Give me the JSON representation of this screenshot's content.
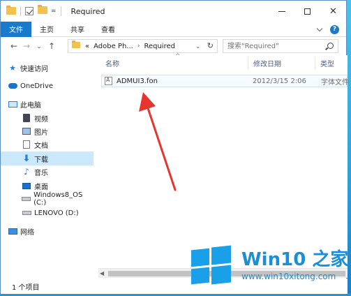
{
  "window": {
    "title": "Required",
    "qa_dropdown": "="
  },
  "ribbon": {
    "file_tab": "文件",
    "tabs": [
      "主页",
      "共享",
      "查看"
    ]
  },
  "address": {
    "prefix": "«",
    "crumbs": [
      "Adobe Ph...",
      "Required"
    ],
    "separator": "›"
  },
  "search": {
    "placeholder": "搜索\"Required\""
  },
  "nav_pane": {
    "items": [
      {
        "label": "快速访问",
        "icon": "star-icon"
      },
      {
        "label": "OneDrive",
        "icon": "onedrive-icon"
      },
      {
        "label": "此电脑",
        "icon": "this-pc-icon"
      },
      {
        "label": "视频",
        "icon": "video-icon"
      },
      {
        "label": "图片",
        "icon": "picture-icon"
      },
      {
        "label": "文档",
        "icon": "document-icon"
      },
      {
        "label": "下载",
        "icon": "download-icon",
        "selected": true
      },
      {
        "label": "音乐",
        "icon": "music-icon"
      },
      {
        "label": "桌面",
        "icon": "desktop-icon"
      },
      {
        "label": "Windows8_OS (C:)",
        "icon": "drive-icon"
      },
      {
        "label": "LENOVO (D:)",
        "icon": "drive-icon"
      },
      {
        "label": "网络",
        "icon": "network-icon"
      }
    ]
  },
  "columns": {
    "name": "名称",
    "modified": "修改日期",
    "type": "类型"
  },
  "files": [
    {
      "name": "ADMUI3.fon",
      "modified": "2012/3/15 2:06",
      "type": "字体文件"
    }
  ],
  "status": {
    "count": "1 个项目"
  },
  "watermark": {
    "title": "Win10 之家",
    "url": "www.win10xitong.com"
  },
  "colors": {
    "accent": "#1979ca",
    "selection": "#cce8ff",
    "annotation": "#e8342f"
  }
}
